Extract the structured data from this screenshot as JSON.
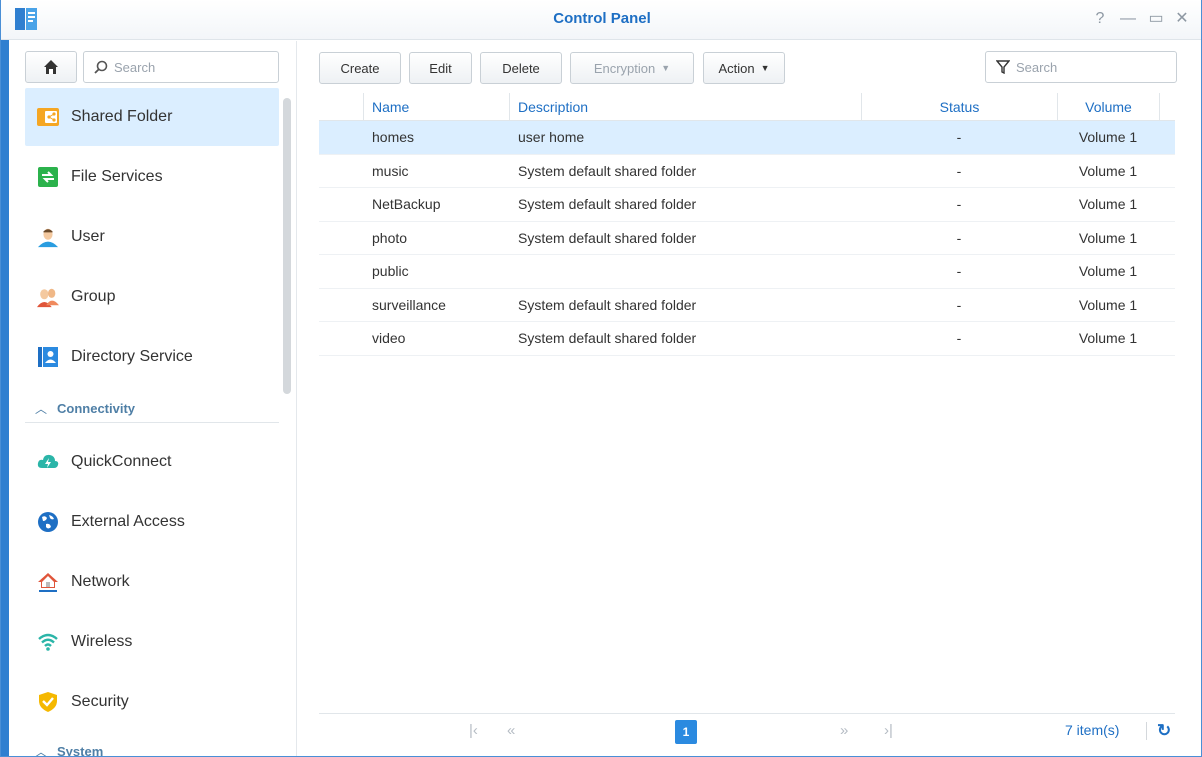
{
  "window": {
    "title": "Control Panel"
  },
  "sidebar": {
    "search_placeholder": "Search",
    "items_top": [
      {
        "label": "Shared Folder",
        "icon": "shared-folder-icon",
        "active": true
      },
      {
        "label": "File Services",
        "icon": "file-services-icon"
      },
      {
        "label": "User",
        "icon": "user-icon"
      },
      {
        "label": "Group",
        "icon": "group-icon"
      },
      {
        "label": "Directory Service",
        "icon": "directory-service-icon"
      }
    ],
    "section_connectivity": "Connectivity",
    "items_connectivity": [
      {
        "label": "QuickConnect",
        "icon": "quickconnect-icon"
      },
      {
        "label": "External Access",
        "icon": "external-access-icon"
      },
      {
        "label": "Network",
        "icon": "network-icon"
      },
      {
        "label": "Wireless",
        "icon": "wireless-icon"
      },
      {
        "label": "Security",
        "icon": "security-icon"
      }
    ],
    "section_system": "System"
  },
  "toolbar": {
    "create": "Create",
    "edit": "Edit",
    "delete": "Delete",
    "encryption": "Encryption",
    "action": "Action",
    "search_placeholder": "Search"
  },
  "table": {
    "columns": [
      "Name",
      "Description",
      "Status",
      "Volume"
    ],
    "rows": [
      {
        "name": "homes",
        "description": "user home",
        "status": "-",
        "volume": "Volume 1"
      },
      {
        "name": "music",
        "description": "System default shared folder",
        "status": "-",
        "volume": "Volume 1"
      },
      {
        "name": "NetBackup",
        "description": "System default shared folder",
        "status": "-",
        "volume": "Volume 1"
      },
      {
        "name": "photo",
        "description": "System default shared folder",
        "status": "-",
        "volume": "Volume 1"
      },
      {
        "name": "public",
        "description": "",
        "status": "-",
        "volume": "Volume 1"
      },
      {
        "name": "surveillance",
        "description": "System default shared folder",
        "status": "-",
        "volume": "Volume 1"
      },
      {
        "name": "video",
        "description": "System default shared folder",
        "status": "-",
        "volume": "Volume 1"
      }
    ]
  },
  "pager": {
    "current_page": "1",
    "item_count": "7 item(s)"
  },
  "colors": {
    "accent": "#1e6fc4",
    "selection": "#dbeeff",
    "frame": "#2f7fd0"
  }
}
